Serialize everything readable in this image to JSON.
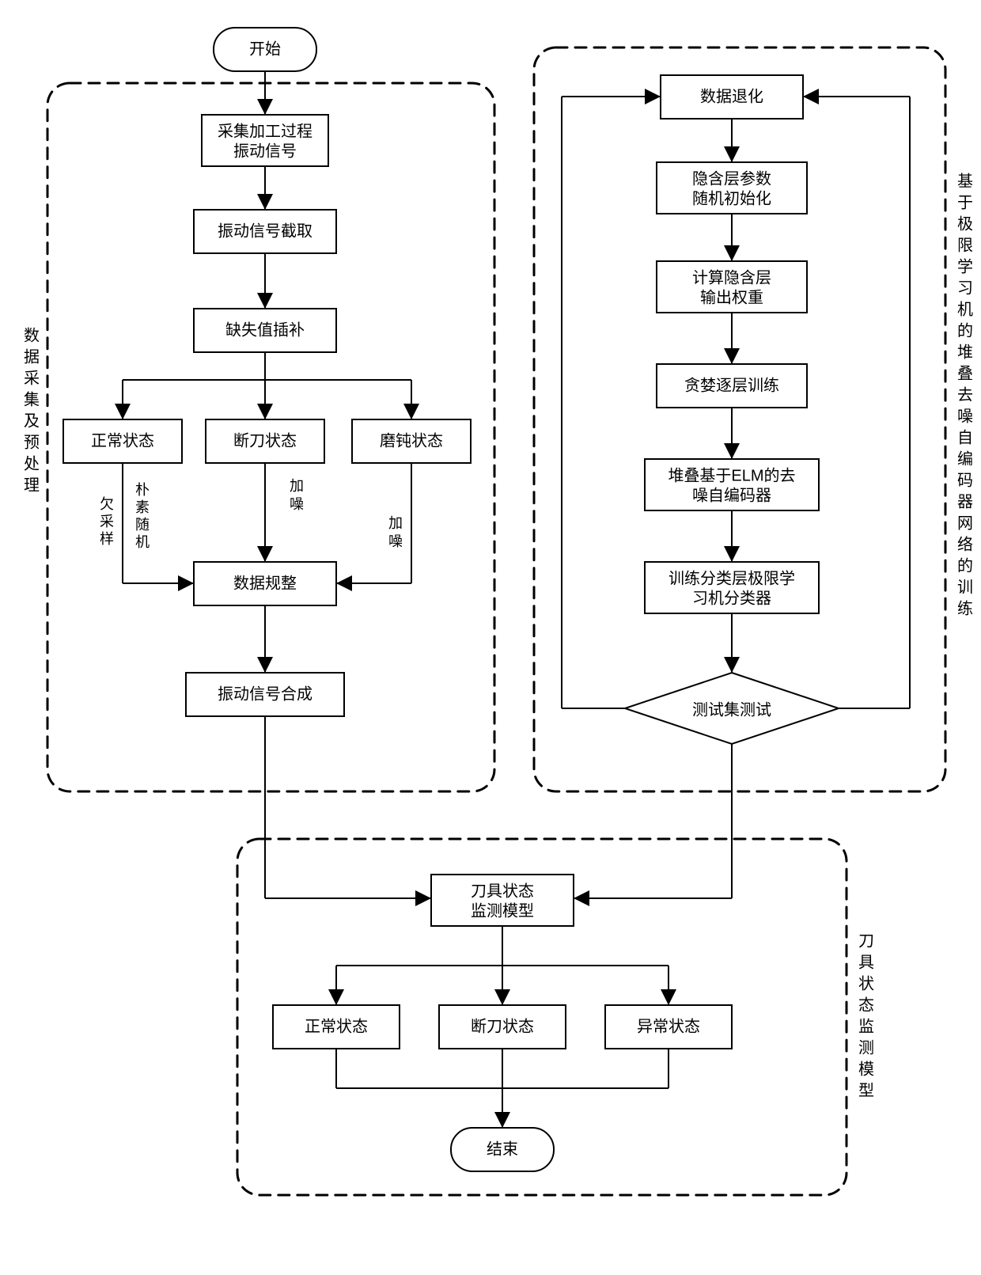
{
  "terminals": {
    "start": "开始",
    "end": "结束"
  },
  "sectionLabels": {
    "left": "数据采集及预处理",
    "right": "基于极限学习机的堆叠去噪自编码器网络的训练",
    "bottom": "刀具状态监测模型"
  },
  "leftBoxes": {
    "b1l1": "采集加工过程",
    "b1l2": "振动信号",
    "b2": "振动信号截取",
    "b3": "缺失值插补",
    "b4a": "正常状态",
    "b4b": "断刀状态",
    "b4c": "磨钝状态",
    "b5": "数据规整",
    "b6": "振动信号合成"
  },
  "edgeLabels": {
    "leftA1": "朴",
    "leftA2": "素",
    "leftA3": "随",
    "leftA4": "机",
    "leftB1": "欠",
    "leftB2": "采",
    "leftB3": "样",
    "mid1": "加",
    "mid2": "噪",
    "right1": "加",
    "right2": "噪"
  },
  "rightBoxes": {
    "r1": "数据退化",
    "r2l1": "隐含层参数",
    "r2l2": "随机初始化",
    "r3l1": "计算隐含层",
    "r3l2": "输出权重",
    "r4": "贪婪逐层训练",
    "r5l1": "堆叠基于ELM的去",
    "r5l2": "噪自编码器",
    "r6l1": "训练分类层极限学",
    "r6l2": "习机分类器",
    "r7": "测试集测试"
  },
  "bottomBoxes": {
    "m1l1": "刀具状态",
    "m1l2": "监测模型",
    "m2a": "正常状态",
    "m2b": "断刀状态",
    "m2c": "异常状态"
  }
}
